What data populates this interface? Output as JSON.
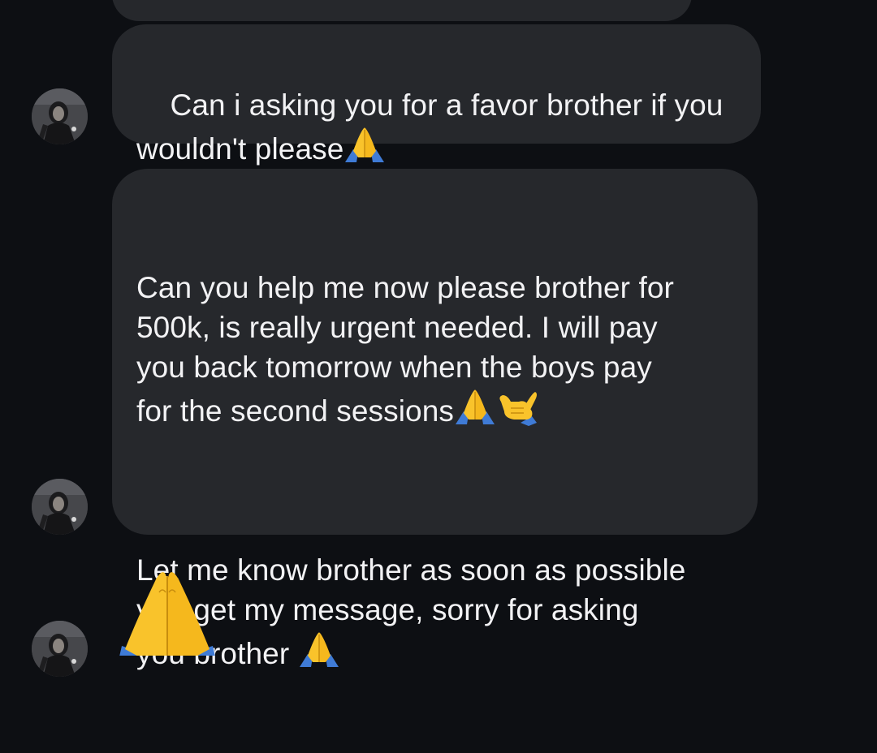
{
  "conversation": {
    "messages": [
      {
        "text": "Can i asking you for a favor brother if you\nwouldn't please",
        "trailing_emoji": [
          "folded-hands-icon"
        ]
      },
      {
        "paragraphs": [
          "Can you help me now please brother for\n500k, is really urgent needed. I will pay\nyou back tomorrow when the boys pay\nfor the second sessions",
          "Let me know brother as soon as possible\nyou get my message, sorry for asking\nyou brother "
        ],
        "trailing_emojis": [
          [
            "folded-hands-icon",
            "call-me-hand-icon"
          ],
          [
            "folded-hands-icon"
          ]
        ]
      },
      {
        "emoji_only": "folded-hands-icon"
      }
    ]
  },
  "colors": {
    "background": "#0d0f13",
    "bubble": "#26282c",
    "text": "#f2f2f4",
    "emoji_skin": "#f9c32b",
    "emoji_sleeve": "#3f7bd6"
  }
}
